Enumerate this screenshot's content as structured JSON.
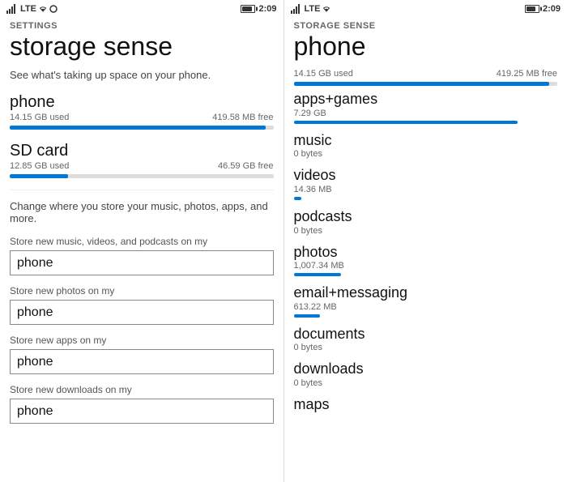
{
  "left": {
    "status": {
      "signal": "signal",
      "network": "LTE",
      "time": "2:09"
    },
    "settings_label": "SETTINGS",
    "title": "storage sense",
    "subtitle": "See what's taking up space on your phone.",
    "phone_storage": {
      "name": "phone",
      "used": "14.15 GB used",
      "free": "419.58 MB free",
      "fill_percent": 97
    },
    "sd_storage": {
      "name": "SD card",
      "used": "12.85 GB used",
      "free": "46.59 GB free",
      "fill_percent": 22
    },
    "change_text": "Change where you store your music, photos, apps, and more.",
    "fields": [
      {
        "label": "Store new music, videos, and podcasts on my",
        "value": "phone"
      },
      {
        "label": "Store new photos on my",
        "value": "phone"
      },
      {
        "label": "Store new apps on my",
        "value": "phone"
      },
      {
        "label": "Store new downloads on my",
        "value": "phone"
      }
    ]
  },
  "right": {
    "status": {
      "signal": "signal",
      "network": "LTE",
      "time": "2:09"
    },
    "settings_label": "STORAGE SENSE",
    "title": "phone",
    "used": "14.15 GB used",
    "free": "419.25 MB free",
    "fill_percent": 97,
    "categories": [
      {
        "name": "apps+games",
        "size": "7.29 GB",
        "bar_percent": 85
      },
      {
        "name": "music",
        "size": "0 bytes",
        "bar_percent": 0
      },
      {
        "name": "videos",
        "size": "14.36 MB",
        "bar_percent": 3
      },
      {
        "name": "podcasts",
        "size": "0 bytes",
        "bar_percent": 0
      },
      {
        "name": "photos",
        "size": "1,007.34 MB",
        "bar_percent": 18
      },
      {
        "name": "email+messaging",
        "size": "613.22 MB",
        "bar_percent": 10
      },
      {
        "name": "documents",
        "size": "0 bytes",
        "bar_percent": 0
      },
      {
        "name": "downloads",
        "size": "0 bytes",
        "bar_percent": 0
      },
      {
        "name": "maps",
        "size": "",
        "bar_percent": 0
      }
    ]
  }
}
